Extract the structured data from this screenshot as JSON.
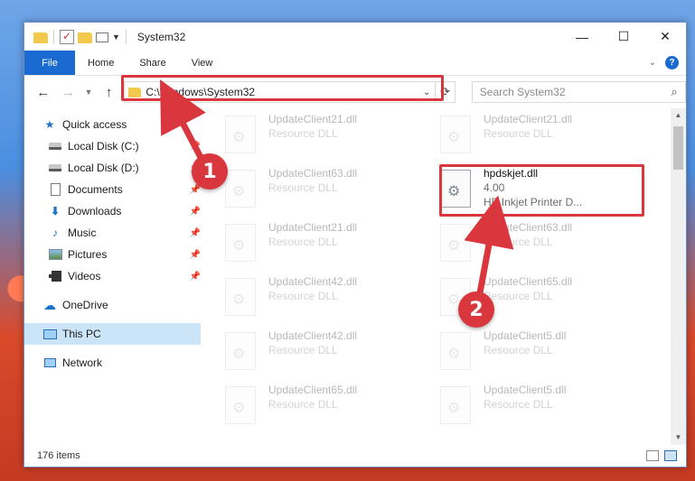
{
  "window": {
    "title": "System32",
    "controls": {
      "minimize": "—",
      "maximize": "☐",
      "close": "✕"
    }
  },
  "ribbon": {
    "tabs": [
      "File",
      "Home",
      "Share",
      "View"
    ],
    "help": "?"
  },
  "address": {
    "path": "C:\\Windows\\System32",
    "search_placeholder": "Search System32"
  },
  "sidebar": {
    "items": [
      {
        "label": "Quick access",
        "icon": "star-icon",
        "pinned": false
      },
      {
        "label": "Local Disk (C:)",
        "icon": "drive-icon",
        "pinned": true
      },
      {
        "label": "Local Disk (D:)",
        "icon": "drive-icon",
        "pinned": true
      },
      {
        "label": "Documents",
        "icon": "document-icon",
        "pinned": true
      },
      {
        "label": "Downloads",
        "icon": "download-icon",
        "pinned": true
      },
      {
        "label": "Music",
        "icon": "music-icon",
        "pinned": true
      },
      {
        "label": "Pictures",
        "icon": "pictures-icon",
        "pinned": true
      },
      {
        "label": "Videos",
        "icon": "video-icon",
        "pinned": true
      },
      {
        "label": "OneDrive",
        "icon": "cloud-icon",
        "pinned": false
      },
      {
        "label": "This PC",
        "icon": "computer-icon",
        "pinned": false,
        "selected": true
      },
      {
        "label": "Network",
        "icon": "network-icon",
        "pinned": false
      }
    ]
  },
  "files": [
    {
      "name": "UpdateClient21.dll",
      "sub": "Resource DLL"
    },
    {
      "name": "UpdateClient21.dll",
      "sub": "Resource DLL"
    },
    {
      "name": "UpdateClient63.dll",
      "sub": "Resource DLL"
    },
    {
      "name": "hpdskjet.dll",
      "sub": "4.00",
      "sub2": "HP Inkjet Printer D...",
      "highlighted": true
    },
    {
      "name": "UpdateClient21.dll",
      "sub": "Resource DLL"
    },
    {
      "name": "UpdateClient63.dll",
      "sub": "Resource DLL"
    },
    {
      "name": "UpdateClient42.dll",
      "sub": "Resource DLL"
    },
    {
      "name": "UpdateClient65.dll",
      "sub": "Resource DLL"
    },
    {
      "name": "UpdateClient42.dll",
      "sub": "Resource DLL"
    },
    {
      "name": "UpdateClient5.dll",
      "sub": "Resource DLL"
    },
    {
      "name": "UpdateClient65.dll",
      "sub": "Resource DLL"
    },
    {
      "name": "UpdateClient5.dll",
      "sub": "Resource DLL"
    }
  ],
  "status": {
    "item_count": "176 items"
  },
  "annotations": {
    "step1": "1",
    "step2": "2",
    "color": "#d9363e"
  }
}
